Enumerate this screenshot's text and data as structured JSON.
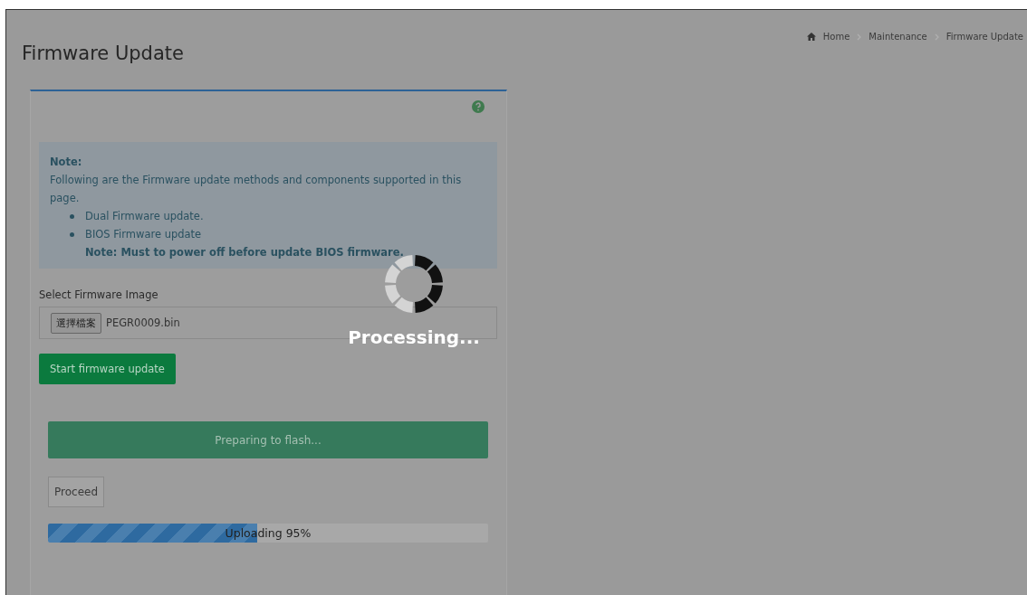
{
  "breadcrumb": [
    {
      "label": "Home"
    },
    {
      "label": "Maintenance"
    },
    {
      "label": "Firmware Update"
    }
  ],
  "title": "Firmware Update",
  "note": {
    "heading": "Note:",
    "intro": "Following are the Firmware update methods and components supported in this page.",
    "items": [
      {
        "text": "Dual Firmware update."
      },
      {
        "text": "BIOS Firmware update",
        "note": "Note: Must to power off before update BIOS firmware."
      }
    ]
  },
  "file_select": {
    "label": "Select Firmware Image",
    "button": "選擇檔案",
    "value": "PEGR0009.bin"
  },
  "start_button": "Start firmware update",
  "status_bar": "Preparing to flash...",
  "proceed_button": "Proceed",
  "upload": {
    "label": "Uploading 95%",
    "level": 0.475
  },
  "overlay": {
    "text": "Processing..."
  }
}
